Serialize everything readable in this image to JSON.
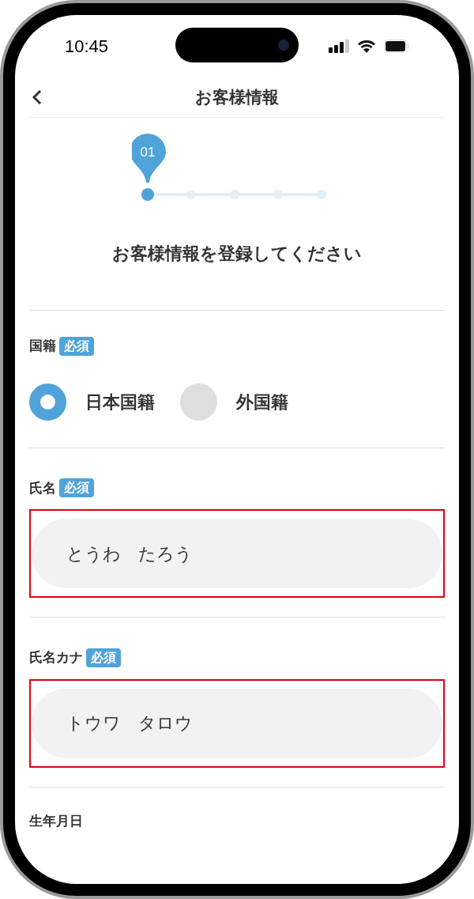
{
  "status_bar": {
    "time": "10:45"
  },
  "header": {
    "title": "お客様情報"
  },
  "stepper": {
    "steps": [
      {
        "label": "01",
        "selected": true
      },
      {
        "selected": false
      },
      {
        "selected": false
      },
      {
        "selected": false
      },
      {
        "selected": false
      }
    ]
  },
  "heading": "お客様情報を登録してください",
  "sections": [
    {
      "kind": "radio",
      "label": "国籍",
      "badge": "必須",
      "options": [
        {
          "label": "日本国籍",
          "selected": true
        },
        {
          "label": "外国籍",
          "selected": false
        }
      ]
    },
    {
      "kind": "text",
      "label": "氏名",
      "badge": "必須",
      "value": "とうわ　たろう",
      "highlighted": true
    },
    {
      "kind": "text",
      "label": "氏名カナ",
      "badge": "必須",
      "value": "トウワ　タロウ",
      "highlighted": true
    },
    {
      "kind": "label",
      "label": "生年月日"
    }
  ]
}
